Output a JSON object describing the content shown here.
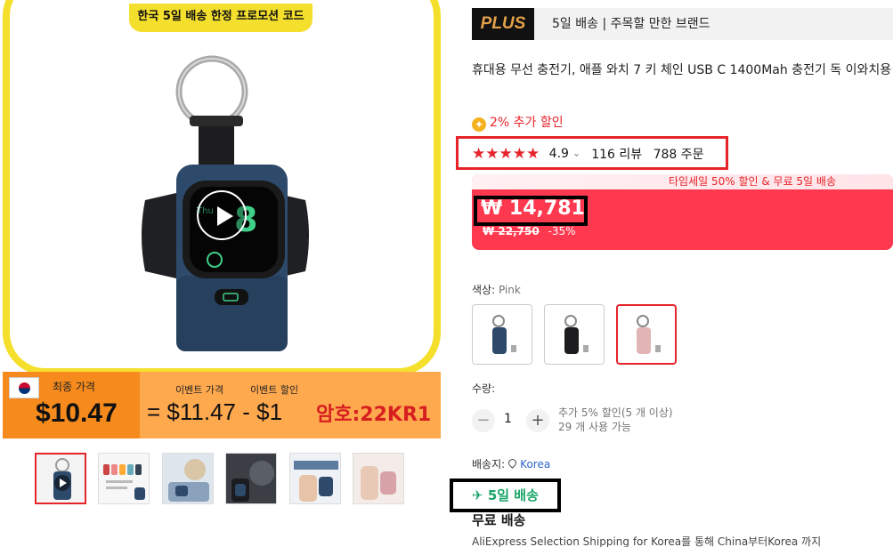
{
  "gallery": {
    "promo_tag": "한국 5일 배송 한정 프로모션 코드",
    "banner": {
      "final_price_label": "최종 가격",
      "final_price": "$10.47",
      "event_price_label": "이벤트 가격",
      "event_discount_label": "이벤트 할인",
      "equation": "= $11.47 - $1",
      "code": "암호:22KR1"
    },
    "thumbnails": [
      "video",
      "colors",
      "charging-device",
      "car-use",
      "hand-use",
      "pink-hand"
    ]
  },
  "store": {
    "logo": "PLUS",
    "text": "5일 배송 | 주목할 만한 브랜드"
  },
  "product": {
    "title": "휴대용 무선 충전기, 애플 와치 7 키 체인 USB C 1400Mah 충전기 독 이와치용",
    "coupon": "2% 추가 할인",
    "stars": "★★★★★",
    "rating": "4.9",
    "reviews": "116 리뷰",
    "orders": "788 주문"
  },
  "price": {
    "promo_line": "타임세일 50% 할인 & 무료 5일 배송",
    "current": "₩ 14,781",
    "original": "₩ 22,750",
    "discount": "-35%"
  },
  "color": {
    "label": "색상:",
    "value": "Pink",
    "swatches": [
      "navy",
      "black",
      "pink"
    ]
  },
  "quantity": {
    "label": "수량:",
    "minus": "−",
    "value": "1",
    "plus": "+",
    "note_1": "추가 5% 할인(5 개 이상)",
    "note_2": "29 개 사용 가능"
  },
  "shipping": {
    "label": "배송지:",
    "country": "Korea",
    "fast": "5일 배송",
    "free": "무료 배송",
    "desc": "AliExpress Selection Shipping for Korea를 통해 China부터Korea 까지"
  },
  "colors": {
    "accent": "#e6242a",
    "price_bg": "#fd384f",
    "banner_yellow": "#f5df2d",
    "banner_orange": "#ffa94f",
    "fast_ship_green": "#1ba66a",
    "link_blue": "#2a66c9"
  }
}
